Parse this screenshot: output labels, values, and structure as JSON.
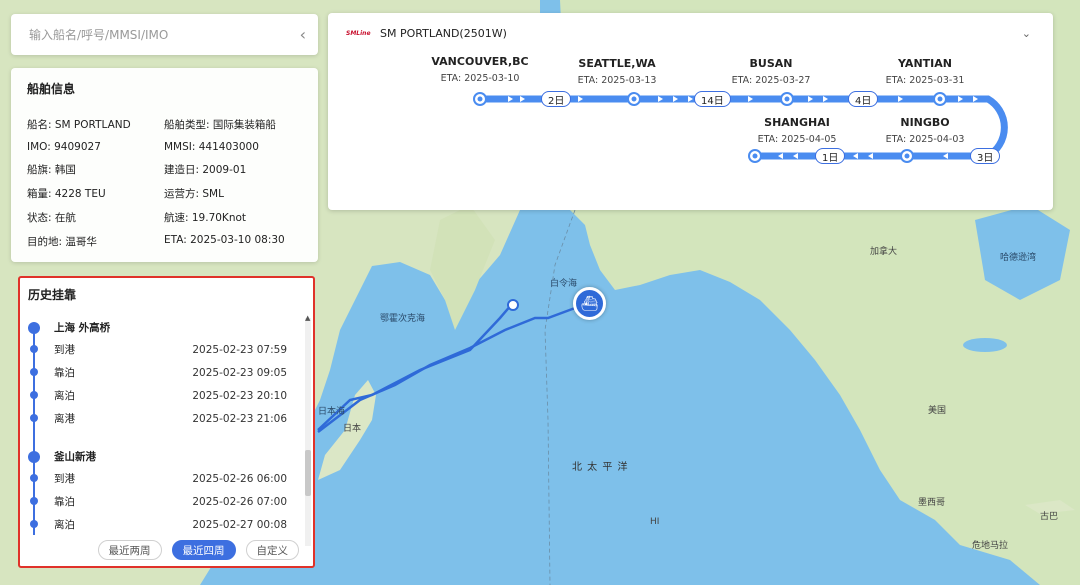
{
  "search": {
    "placeholder": "输入船名/呼号/MMSI/IMO"
  },
  "ship_info": {
    "title": "船舶信息",
    "fields": [
      "船名:  SM PORTLAND",
      "船舶类型: 国际集装箱船",
      "IMO: 9409027",
      "MMSI: 441403000",
      "船旗: 韩国",
      "建造日: 2009-01",
      "箱量: 4228 TEU",
      "运营方: SML",
      "状态: 在航",
      "航速: 19.70Knot",
      "目的地: 温哥华",
      "ETA: 2025-03-10 08:30"
    ]
  },
  "history": {
    "title": "历史挂靠",
    "ports": [
      {
        "name": "上海 外高桥",
        "events": [
          {
            "label": "到港",
            "time": "2025-02-23 07:59"
          },
          {
            "label": "靠泊",
            "time": "2025-02-23 09:05"
          },
          {
            "label": "离泊",
            "time": "2025-02-23 20:10"
          },
          {
            "label": "离港",
            "time": "2025-02-23 21:06"
          }
        ]
      },
      {
        "name": "釜山新港",
        "events": [
          {
            "label": "到港",
            "time": "2025-02-26 06:00"
          },
          {
            "label": "靠泊",
            "time": "2025-02-26 07:00"
          },
          {
            "label": "离泊",
            "time": "2025-02-27 00:08"
          }
        ]
      }
    ],
    "buttons": [
      "最近两周",
      "最近四周",
      "自定义"
    ],
    "active_button": "最近四周"
  },
  "voyage": {
    "title": "SM PORTLAND(2501W)",
    "logo_text": "SMLine",
    "stops": [
      {
        "name": "VANCOUVER,BC",
        "eta": "ETA: 2025-03-10"
      },
      {
        "name": "SEATTLE,WA",
        "eta": "ETA: 2025-03-13"
      },
      {
        "name": "BUSAN",
        "eta": "ETA: 2025-03-27"
      },
      {
        "name": "YANTIAN",
        "eta": "ETA: 2025-03-31"
      },
      {
        "name": "NINGBO",
        "eta": "ETA: 2025-04-03"
      },
      {
        "name": "SHANGHAI",
        "eta": "ETA: 2025-04-05"
      }
    ],
    "durations": [
      "2日",
      "14日",
      "4日",
      "3日",
      "1日"
    ]
  },
  "map": {
    "labels": {
      "pacific": "北 太 平 洋",
      "canada": "加拿大",
      "usa": "美国",
      "mexico": "墨西哥",
      "japan": "日本",
      "sea_of_japan": "日本海",
      "bering": "白令海",
      "okhotsk": "鄂霍次克海",
      "hudson": "哈德逊湾",
      "guatemala": "危地马拉",
      "cuba": "古巴",
      "hi": "HI"
    },
    "colors": {
      "route": "#2f6ad8",
      "sea": "#7ec0ea",
      "land": "#cfe3b9"
    }
  }
}
